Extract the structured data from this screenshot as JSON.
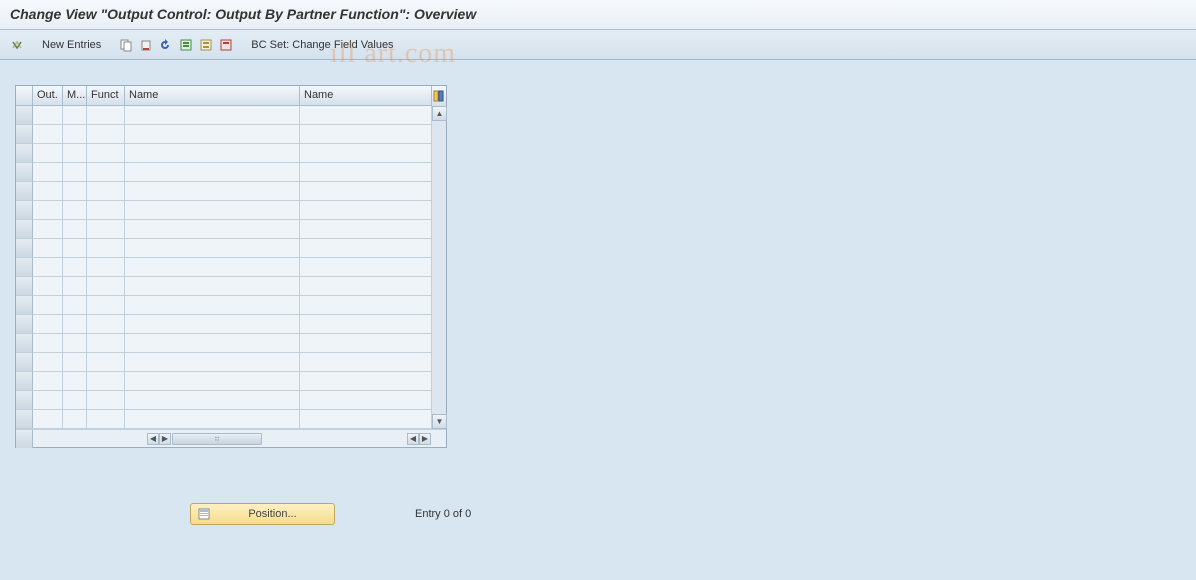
{
  "title": "Change View \"Output Control: Output By Partner Function\": Overview",
  "toolbar": {
    "new_entries": "New Entries",
    "bc_set": "BC Set: Change Field Values"
  },
  "grid": {
    "columns": {
      "sel": "",
      "out": "Out.",
      "m": "M...",
      "funct": "Funct",
      "name1": "Name",
      "name2": "Name"
    }
  },
  "footer": {
    "position_button": "Position...",
    "entry_status": "Entry 0 of 0"
  },
  "watermark": "ıll art.com"
}
